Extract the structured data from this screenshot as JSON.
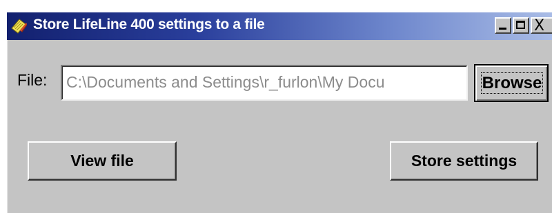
{
  "window": {
    "title": "Store LifeLine 400 settings to a file",
    "icon": "pencil-paper-icon",
    "controls": {
      "minimize": "minimize-icon",
      "maximize": "maximize-icon",
      "close": "close-icon",
      "close_glyph": "X"
    }
  },
  "form": {
    "file_label": "File:",
    "file_value": "C:\\Documents and Settings\\r_furlon\\My Docu",
    "browse_label": "Browse"
  },
  "actions": {
    "view_label": "View file",
    "store_label": "Store settings"
  },
  "colors": {
    "titlebar_start": "#12206e",
    "titlebar_end": "#a9bce6",
    "face": "#c4c4c4",
    "input_text": "#8c8c8c"
  }
}
